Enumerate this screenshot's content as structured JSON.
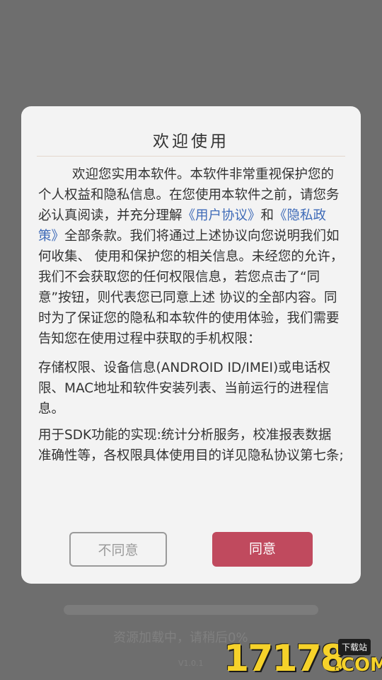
{
  "dialog": {
    "title": "欢迎使用",
    "para1_intro": "欢迎您实用本软件。本软件非常重视保护您的个人权益和隐私信息。在您使用本软件之前，请您务必认真阅读，并充分理解",
    "user_agreement_link": "《用户协议》",
    "and_text": "和",
    "privacy_policy_link": "《隐私政策》",
    "para1_rest": "全部条款。我们将通过上述协议向您说明我们如何收集、 使用和保护您的相关信息。未经您的允许，我们不会获取您的任何权限信息，若您点击了“同意”按钮，则代表您已同意上述 协议的全部内容。同时为了保证您的隐私和本软件的使用体验，我们需要告知您在使用过程中获取的手机权限：",
    "para2": "存储权限、设备信息(ANDROID ID/IMEI)或电话权限、MAC地址和软件安装列表、当前运行的进程信息。",
    "para3": "用于SDK功能的实现:统计分析服务，校准报表数据准确性等，各权限具体使用目的详见隐私协议第七条;",
    "disagree_label": "不同意",
    "agree_label": "同意"
  },
  "loading": {
    "text": "资源加载中，请稍后0%",
    "progress": 0,
    "version": "V1.0.1"
  },
  "watermark": {
    "number": "17178",
    "badge": "下载站",
    "domain": ".COM"
  },
  "colors": {
    "agree_button": "#c04a5e",
    "link": "#3f6bb8",
    "overlay": "#6e6e6e"
  }
}
